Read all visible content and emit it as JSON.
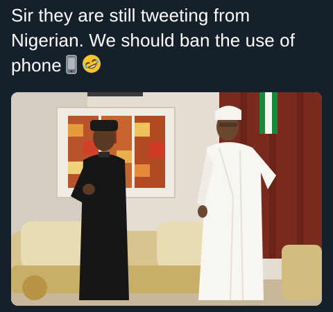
{
  "tweet": {
    "text": "Sir they are still tweeting from Nigerian. We should ban the use of phone",
    "emojis": [
      "mobile-phone-icon",
      "rolling-on-floor-laughing-emoji"
    ]
  },
  "photo": {
    "description_alt": "two men conversing in a sitting room"
  }
}
